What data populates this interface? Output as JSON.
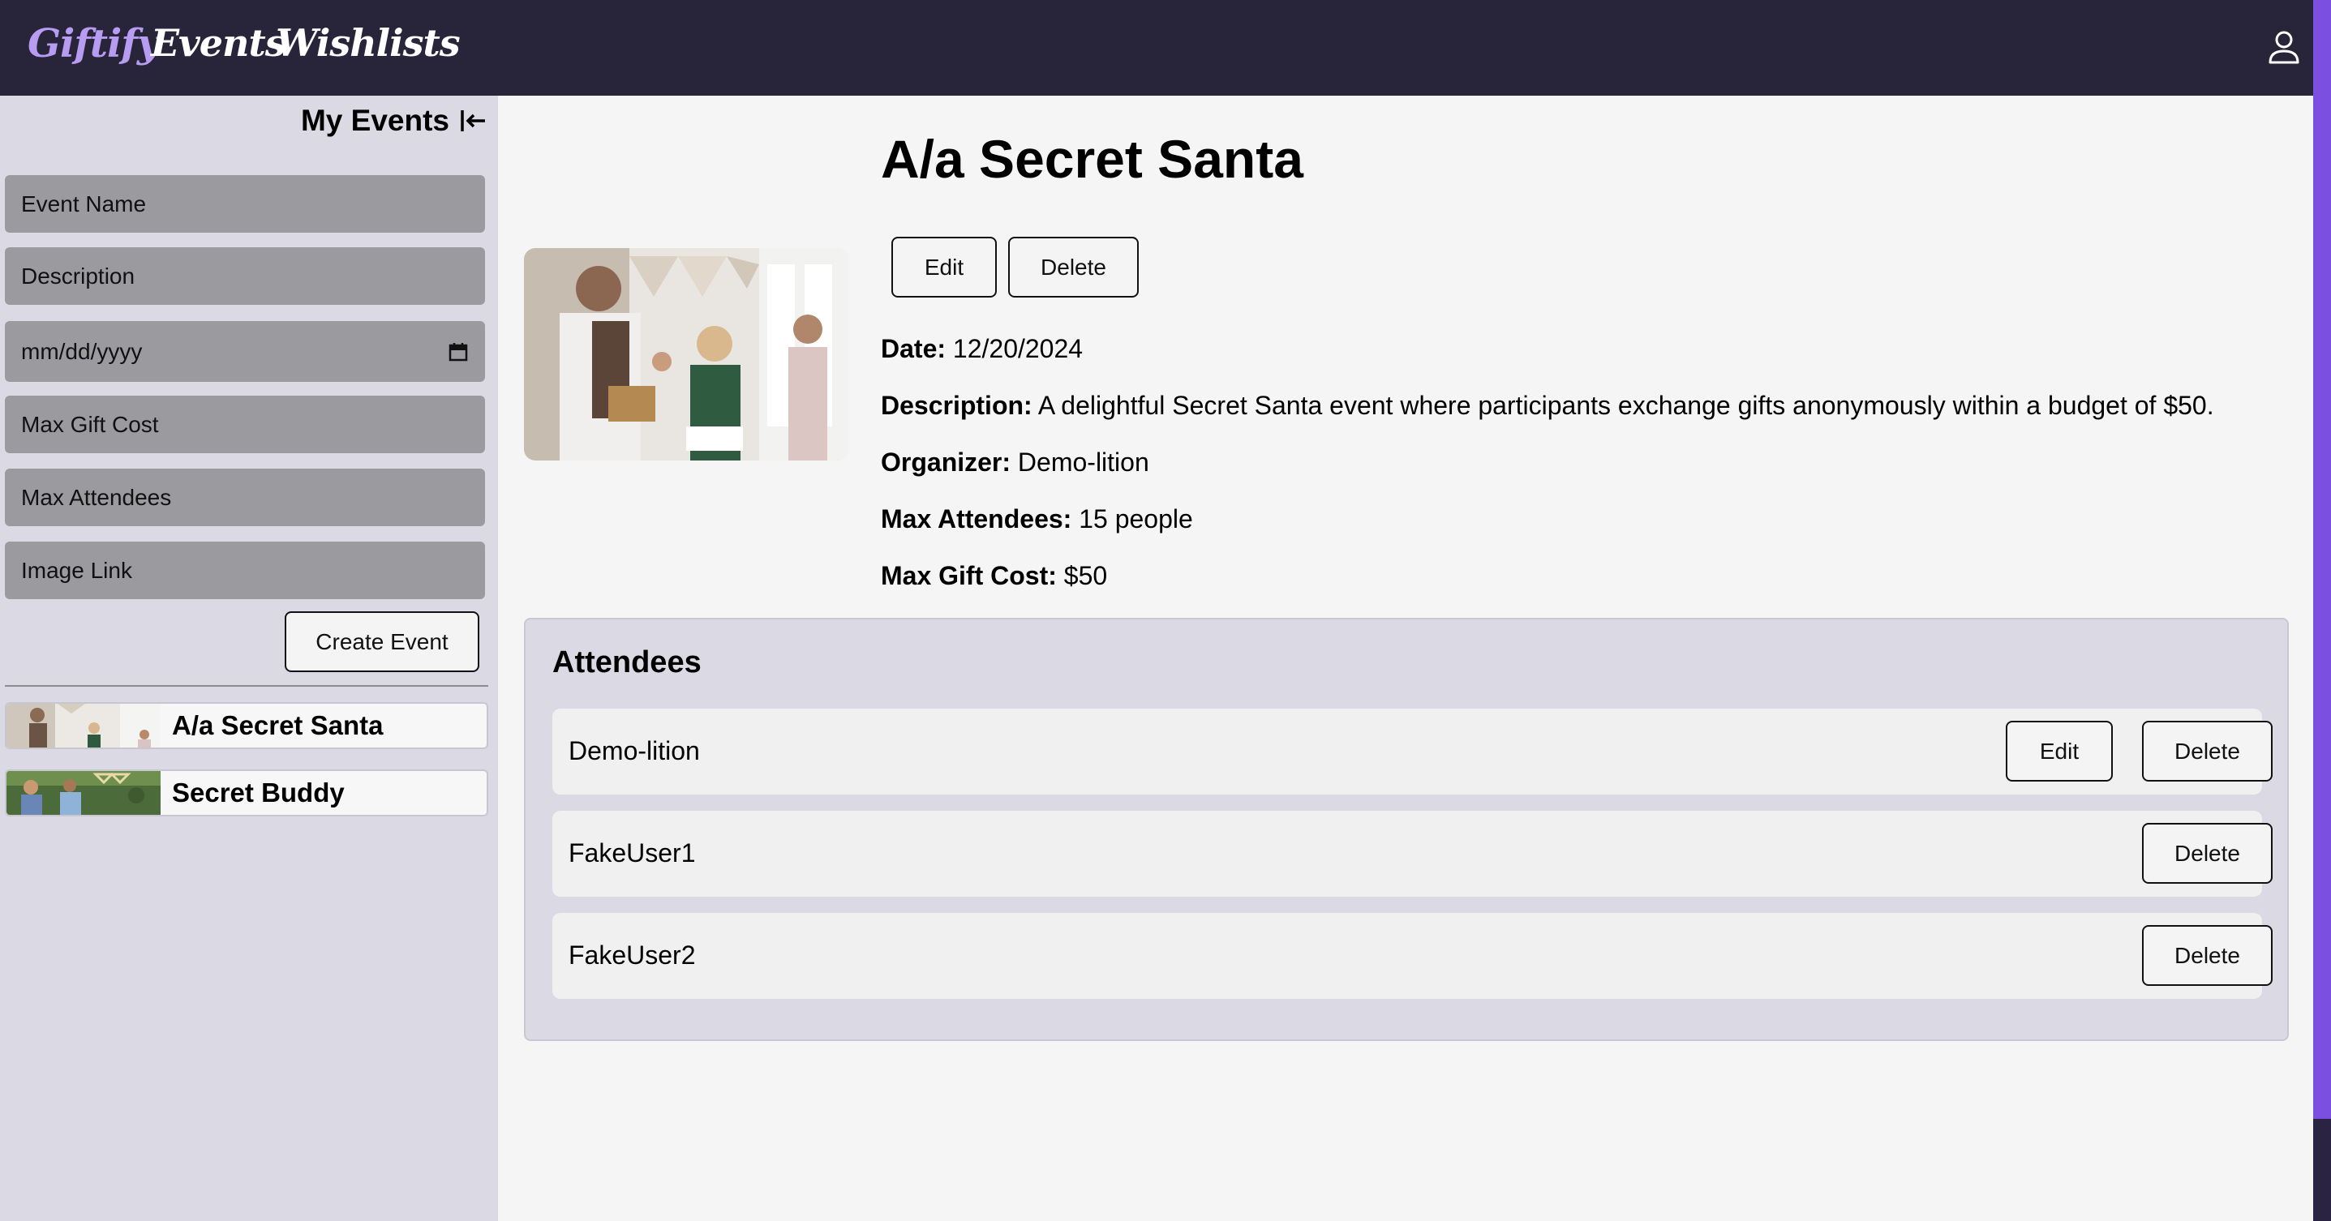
{
  "nav": {
    "brand": "Giftify",
    "links": [
      "Events",
      "Wishlists"
    ]
  },
  "sidebar": {
    "title": "My Events",
    "form": {
      "name_placeholder": "Event Name",
      "description_placeholder": "Description",
      "date_placeholder": "mm/dd/yyyy",
      "max_gift_cost_placeholder": "Max Gift Cost",
      "max_attendees_placeholder": "Max Attendees",
      "image_link_placeholder": "Image Link",
      "create_label": "Create Event"
    },
    "events": [
      {
        "name": "A/a Secret Santa"
      },
      {
        "name": "Secret Buddy"
      }
    ]
  },
  "event": {
    "title": "A/a Secret Santa",
    "edit_label": "Edit",
    "delete_label": "Delete",
    "details": {
      "date_label": "Date:",
      "date": "12/20/2024",
      "description_label": "Description:",
      "description": "A delightful Secret Santa event where participants exchange gifts anonymously within a budget of $50.",
      "organizer_label": "Organizer:",
      "organizer": "Demo-lition",
      "max_attendees_label": "Max Attendees:",
      "max_attendees": "15 people",
      "max_gift_cost_label": "Max Gift Cost:",
      "max_gift_cost": "$50"
    }
  },
  "attendees": {
    "title": "Attendees",
    "edit_label": "Edit",
    "delete_label": "Delete",
    "list": [
      {
        "name": "Demo-lition"
      },
      {
        "name": "FakeUser1"
      },
      {
        "name": "FakeUser2"
      }
    ]
  },
  "colors": {
    "topbar": "#28253a",
    "brand": "#b79cf2",
    "sidebar": "#dbd9e3",
    "field": "#9b9a9f",
    "accent_strip": "#7b4fe0"
  },
  "icons": {
    "profile": "user-icon",
    "collapse": "collapse-left-icon",
    "calendar": "calendar-icon"
  }
}
